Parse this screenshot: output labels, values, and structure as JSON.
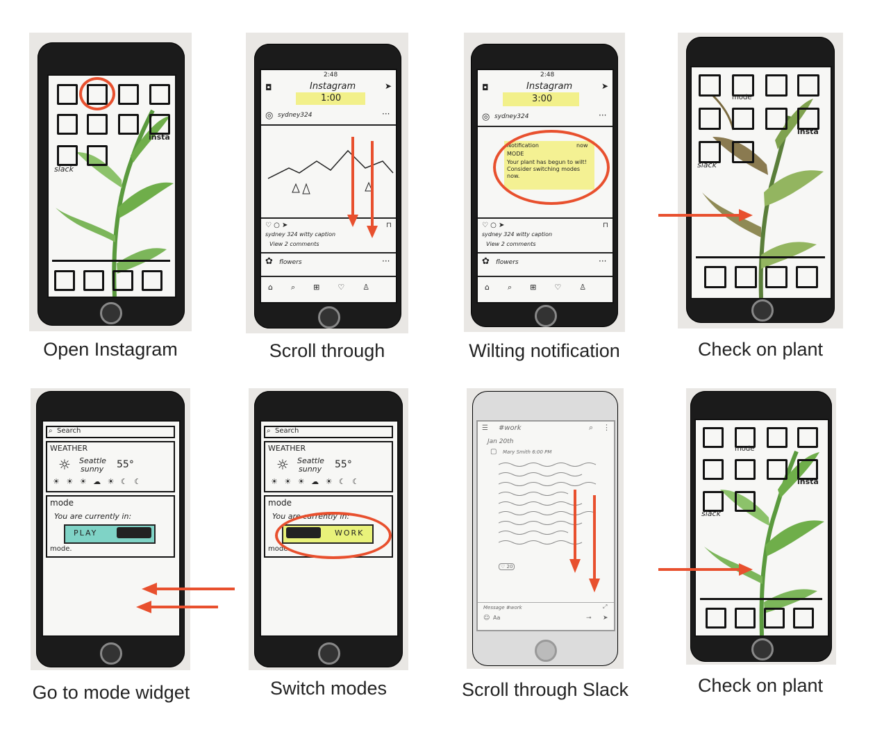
{
  "colors": {
    "accent_red": "#e8502e",
    "sticky_yellow": "#f2f08a",
    "toggle_teal": "#7fd3c6",
    "toggle_yellow": "#e9f27a",
    "leaf_green": "#6fae4a"
  },
  "panels": [
    {
      "caption": "Open Instagram"
    },
    {
      "caption": "Scroll through"
    },
    {
      "caption": "Wilting notification"
    },
    {
      "caption": "Check on plant"
    },
    {
      "caption": "Go to mode widget"
    },
    {
      "caption": "Switch modes"
    },
    {
      "caption": "Scroll through Slack"
    },
    {
      "caption": "Check on plant"
    }
  ],
  "home": {
    "mode_label": "mode",
    "insta_label": "insta",
    "slack_label": "slack"
  },
  "instagram": {
    "status_time": "2:48",
    "title": "Instagram",
    "timer_1": "1:00",
    "timer_3": "3:00",
    "user": "sydney324",
    "caption_line": "sydney 324  witty  caption",
    "comments": "View  2  comments",
    "next_user": "flowers"
  },
  "notification": {
    "header": "Notification",
    "when": "now",
    "app": "MODE",
    "body": "Your plant has begun to wilt! Consider switching modes now."
  },
  "widget": {
    "search": "Search",
    "weather_title": "WEATHER",
    "city": "Seattle",
    "condition": "sunny",
    "temp": "55°",
    "forecast_icons": "☀ ☀ ☀ ☁ ☀ ☾ ☾",
    "mode_title": "mode",
    "currently": "You are currently in:",
    "play": "PLAY",
    "work": "WORK",
    "mode_footer": "mode."
  },
  "slack": {
    "channel": "#work",
    "date": "Jan 20th",
    "sender": "Mary Smith  6:00 PM",
    "reaction": "♡ 20",
    "composer": "Message #work",
    "composer_hint": "Aa"
  }
}
